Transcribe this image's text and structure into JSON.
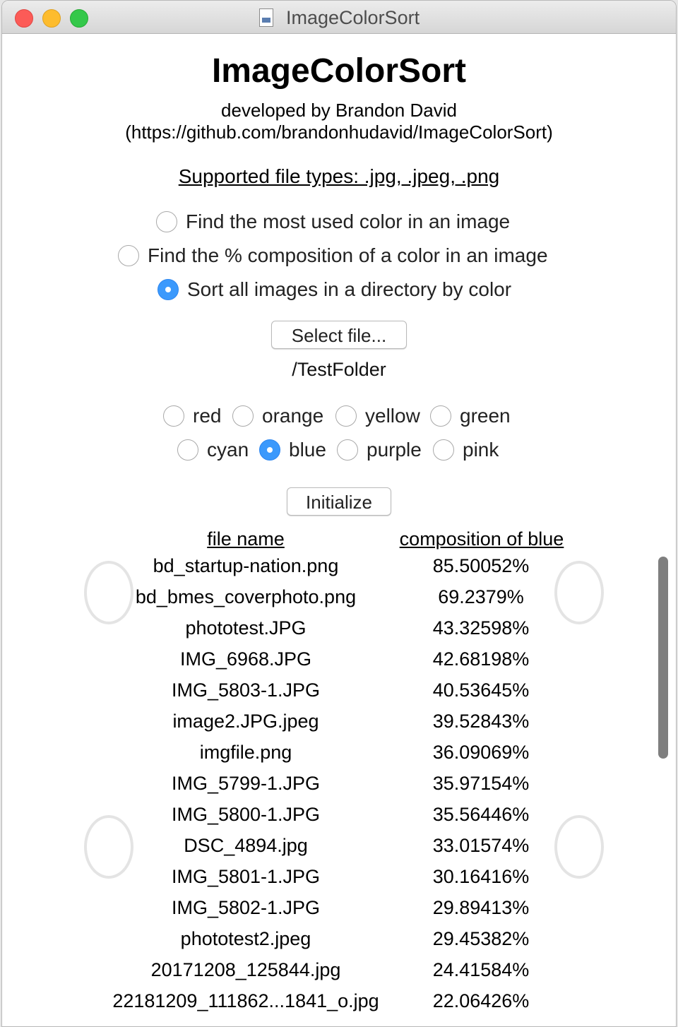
{
  "window": {
    "title": "ImageColorSort"
  },
  "header": {
    "app_title": "ImageColorSort",
    "developer": "developed by Brandon David",
    "url": "(https://github.com/brandonhudavid/ImageColorSort)",
    "supported_types": "Supported file types: .jpg, .jpeg, .png"
  },
  "modes": [
    {
      "label": "Find the most used color in an image",
      "selected": false
    },
    {
      "label": "Find the % composition of a color in an image",
      "selected": false
    },
    {
      "label": "Sort all images in a directory by color",
      "selected": true
    }
  ],
  "select_file_button": "Select file...",
  "selected_path": "/TestFolder",
  "colors": [
    {
      "label": "red",
      "selected": false
    },
    {
      "label": "orange",
      "selected": false
    },
    {
      "label": "yellow",
      "selected": false
    },
    {
      "label": "green",
      "selected": false
    },
    {
      "label": "cyan",
      "selected": false
    },
    {
      "label": "blue",
      "selected": true
    },
    {
      "label": "purple",
      "selected": false
    },
    {
      "label": "pink",
      "selected": false
    }
  ],
  "initialize_button": "Initialize",
  "table": {
    "columns": [
      "file name",
      "composition of blue"
    ],
    "rows": [
      [
        "bd_startup-nation.png",
        "85.50052%"
      ],
      [
        "bd_bmes_coverphoto.png",
        "69.2379%"
      ],
      [
        "phototest.JPG",
        "43.32598%"
      ],
      [
        "IMG_6968.JPG",
        "42.68198%"
      ],
      [
        "IMG_5803-1.JPG",
        "40.53645%"
      ],
      [
        "image2.JPG.jpeg",
        "39.52843%"
      ],
      [
        "imgfile.png",
        "36.09069%"
      ],
      [
        "IMG_5799-1.JPG",
        "35.97154%"
      ],
      [
        "IMG_5800-1.JPG",
        "35.56446%"
      ],
      [
        "DSC_4894.jpg",
        "33.01574%"
      ],
      [
        "IMG_5801-1.JPG",
        "30.16416%"
      ],
      [
        "IMG_5802-1.JPG",
        "29.89413%"
      ],
      [
        "phototest2.jpeg",
        "29.45382%"
      ],
      [
        "20171208_125844.jpg",
        "24.41584%"
      ],
      [
        "22181209_111862...1841_o.jpg",
        "22.06426%"
      ]
    ]
  },
  "accent_color": "#3b99fc"
}
